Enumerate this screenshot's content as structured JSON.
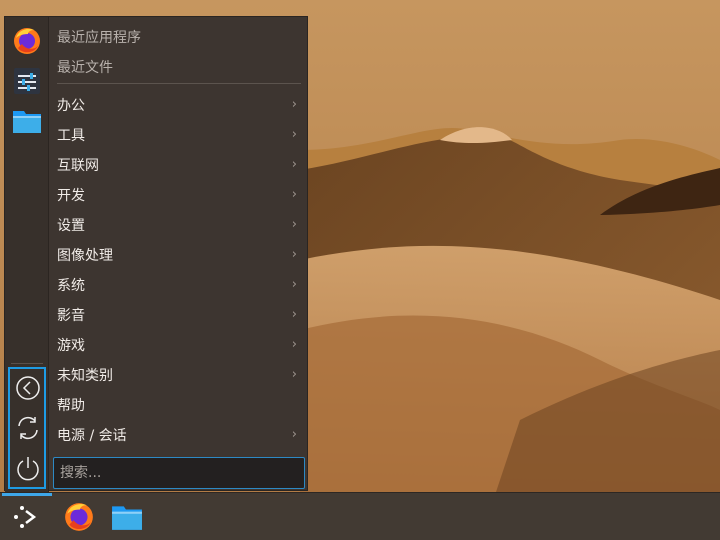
{
  "menu": {
    "recent_apps": "最近应用程序",
    "recent_files": "最近文件",
    "categories": [
      {
        "label": "办公",
        "has_submenu": true
      },
      {
        "label": "工具",
        "has_submenu": true
      },
      {
        "label": "互联网",
        "has_submenu": true
      },
      {
        "label": "开发",
        "has_submenu": true
      },
      {
        "label": "设置",
        "has_submenu": true
      },
      {
        "label": "图像处理",
        "has_submenu": true
      },
      {
        "label": "系统",
        "has_submenu": true
      },
      {
        "label": "影音",
        "has_submenu": true
      },
      {
        "label": "游戏",
        "has_submenu": true
      },
      {
        "label": "未知类别",
        "has_submenu": true
      },
      {
        "label": "帮助",
        "has_submenu": false
      },
      {
        "label": "电源 / 会话",
        "has_submenu": true
      }
    ],
    "chevron": "›",
    "search_placeholder": "搜索..."
  },
  "favorites": [
    "firefox-icon",
    "settings-icon",
    "folder-icon"
  ],
  "session_buttons": [
    "lock-screen-icon",
    "switch-user-icon",
    "power-icon"
  ],
  "taskbar": {
    "items": [
      "application-launcher-icon",
      "firefox-icon",
      "folder-icon"
    ]
  },
  "colors": {
    "accent": "#1e9be4",
    "panel": "#3d3530",
    "taskbar": "#423a33"
  }
}
